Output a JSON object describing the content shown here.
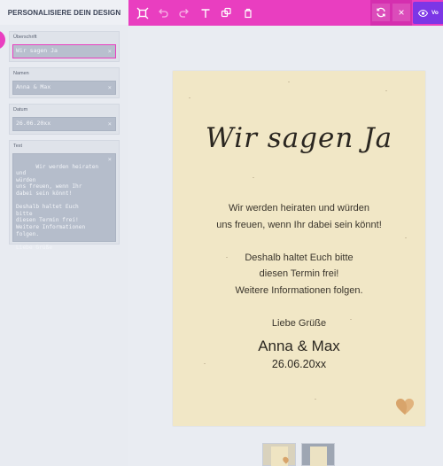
{
  "sidebar": {
    "title": "PERSONALISIERE DEIN DESIGN",
    "fields": [
      {
        "label": "Überschrift",
        "value": "Wir sagen Ja"
      },
      {
        "label": "Namen",
        "value": "Anna & Max"
      },
      {
        "label": "Datum",
        "value": "26.06.20xx"
      },
      {
        "label": "Text",
        "value": "Wir werden heiraten und\nwürden\nuns freuen, wenn Ihr\ndabei sein könnt!\n\nDeshalb haltet Euch\nbitte\ndiesen Termin frei!\nWeitere Informationen\nfolgen.\n\nLiebe Grüße"
      }
    ],
    "clear_glyph": "×"
  },
  "toolbar": {
    "icons": [
      "grid-select-icon",
      "undo-icon",
      "redo-icon",
      "text-icon",
      "shape-icon",
      "trash-icon"
    ],
    "refresh_icon": "refresh-icon",
    "close_glyph": "×",
    "preview_label": "Vo"
  },
  "colors": {
    "accent_pink": "#e93ec0",
    "preview_purple": "#7c36e6",
    "card_background": "#f1e7c6",
    "heart": "#d8a46b"
  },
  "card": {
    "headline": "Wir sagen Ja",
    "body_lines": [
      "Wir werden heiraten und würden",
      "uns freuen, wenn Ihr dabei sein könnt!",
      "",
      "Deshalb haltet Euch bitte",
      "diesen Termin frei!",
      "Weitere Informationen folgen.",
      "",
      "Liebe Grüße"
    ],
    "names": "Anna & Max",
    "date": "26.06.20xx",
    "heart_icon": "heart-icon"
  },
  "pages": [
    "page-1-thumbnail",
    "page-2-thumbnail"
  ]
}
